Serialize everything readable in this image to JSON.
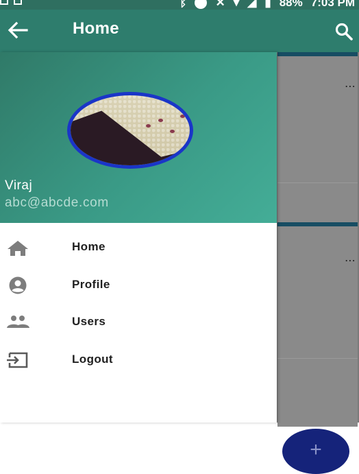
{
  "status_bar": {
    "battery": "88%",
    "time": "7:03 PM"
  },
  "app_bar": {
    "title": "Home",
    "back_icon": "arrow-back-icon",
    "search_icon": "search-icon"
  },
  "drawer": {
    "user": {
      "name": "Viraj",
      "email": "abc@abcde.com"
    },
    "items": [
      {
        "label": "Home",
        "icon": "home-icon"
      },
      {
        "label": "Profile",
        "icon": "account-circle-icon"
      },
      {
        "label": "Users",
        "icon": "people-icon"
      },
      {
        "label": "Logout",
        "icon": "exit-icon"
      }
    ]
  },
  "background": {
    "more_icon": "⋯"
  },
  "fab": {
    "icon": "+"
  },
  "colors": {
    "primary": "#2e7d6d",
    "drawer_header": "#3a9a86",
    "avatar_border": "#1a35c8",
    "fab": "#15237a",
    "scrim": "#7a7a7a"
  }
}
